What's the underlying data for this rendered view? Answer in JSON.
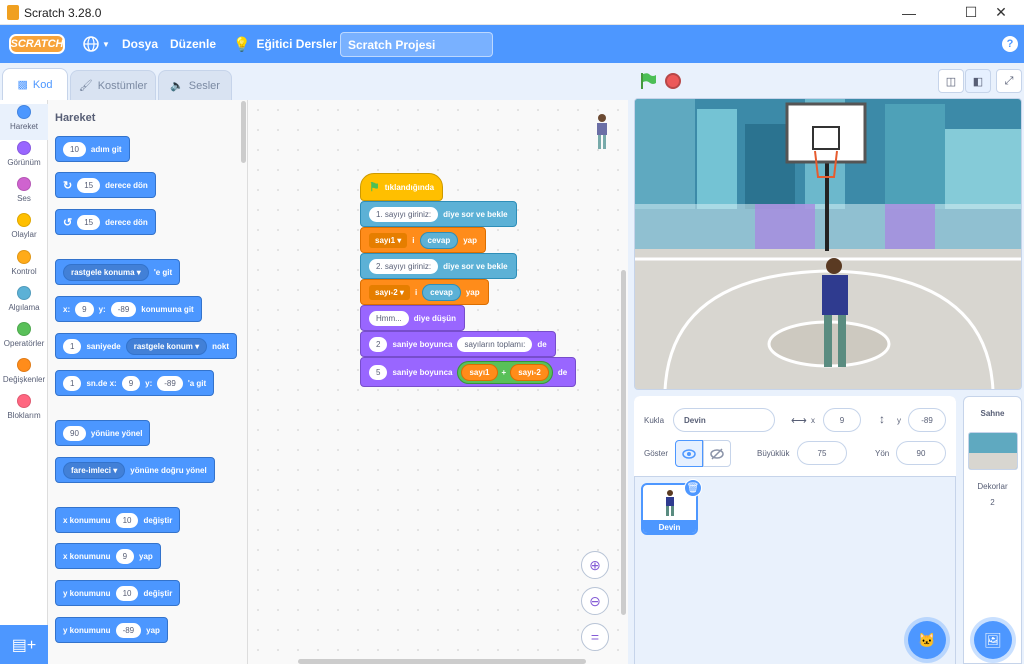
{
  "window": {
    "title": "Scratch 3.28.0"
  },
  "menu": {
    "file": "Dosya",
    "edit": "Düzenle",
    "tutorials": "Eğitici Dersler",
    "project_title": "Scratch Projesi",
    "logo": "SCRATCH"
  },
  "tabs": {
    "code": "Kod",
    "costumes": "Kostümler",
    "sounds": "Sesler"
  },
  "categories": [
    {
      "label": "Hareket",
      "color": "#4c97ff"
    },
    {
      "label": "Görünüm",
      "color": "#9966ff"
    },
    {
      "label": "Ses",
      "color": "#cf63cf"
    },
    {
      "label": "Olaylar",
      "color": "#ffbf00"
    },
    {
      "label": "Kontrol",
      "color": "#ffab19"
    },
    {
      "label": "Algılama",
      "color": "#5cb1d6"
    },
    {
      "label": "Operatörler",
      "color": "#59c059"
    },
    {
      "label": "Değişkenler",
      "color": "#ff8c1a"
    },
    {
      "label": "Bloklarım",
      "color": "#ff6680"
    }
  ],
  "palette": {
    "title": "Hareket",
    "move_steps": "10",
    "move_label": "adım git",
    "turn_right_deg": "15",
    "turn_right_label": "derece dön",
    "turn_left_deg": "15",
    "turn_left_label": "derece dön",
    "goto_dd": "rastgele konuma",
    "goto_label": "'e git",
    "gotoxy_x_label": "x:",
    "gotoxy_x": "9",
    "gotoxy_y_label": "y:",
    "gotoxy_y": "-89",
    "gotoxy_label": "konumuna git",
    "glide_secs": "1",
    "glide_label1": "saniyede",
    "glide_dd": "rastgele konum",
    "glide_label2": "nokt",
    "glidexy_secs": "1",
    "glidexy_label": "sn.de x:",
    "glidexy_x": "9",
    "glidexy_y_label": "y:",
    "glidexy_y": "-89",
    "glidexy_label2": "'a git",
    "point_dir": "90",
    "point_label": "yönüne yönel",
    "pointto_dd": "fare-imleci",
    "pointto_label": "yönüne doğru yönel",
    "changex_label": "x konumunu",
    "changex_val": "10",
    "changex_label2": "değiştir",
    "setx_label": "x konumunu",
    "setx_val": "9",
    "setx_label2": "yap",
    "changey_label": "y konumunu",
    "changey_val": "10",
    "changey_label2": "değiştir",
    "sety_label": "y konumunu",
    "sety_val": "-89",
    "sety_label2": "yap"
  },
  "script": {
    "hat": "tıklandığında",
    "ask1": "1. sayıyı giriniz:",
    "ask_label": "diye sor ve bekle",
    "set1_var": "sayı1",
    "set1_mid": "i",
    "set1_val": "cevap",
    "set_label": "yap",
    "ask2": "2. sayıyı giriniz:",
    "ask2_label": "diye sor ve bekle",
    "set2_var": "sayı-2",
    "set2_mid": "i",
    "set2_val": "cevap",
    "set2_label": "yap",
    "think_val": "Hmm...",
    "think_label": "diye düşün",
    "say1_secs": "2",
    "say1_label": "saniye boyunca",
    "say1_val": "sayıların toplamı:",
    "say1_end": "de",
    "say2_secs": "5",
    "say2_label": "saniye boyunca",
    "say2_a": "sayı1",
    "say2_op": "+",
    "say2_b": "sayı-2",
    "say2_end": "de"
  },
  "sprite_info": {
    "sprite_label": "Kukla",
    "sprite_name": "Devin",
    "x_label": "x",
    "x": "9",
    "y_label": "y",
    "y": "-89",
    "show_label": "Göster",
    "size_label": "Büyüklük",
    "size": "75",
    "dir_label": "Yön",
    "direction": "90"
  },
  "sprites": [
    {
      "name": "Devin"
    }
  ],
  "stage_pane": {
    "title": "Sahne",
    "backdrops_label": "Dekorlar",
    "backdrops_count": "2"
  }
}
